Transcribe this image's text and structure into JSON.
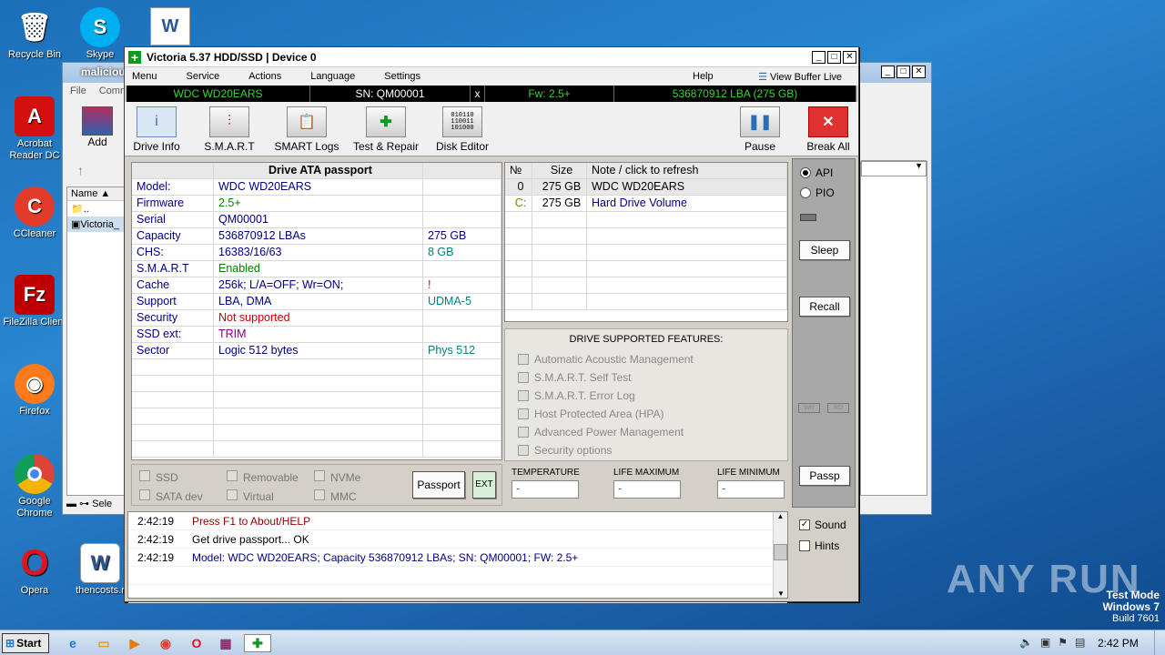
{
  "desktop": {
    "icons": [
      {
        "label": "Recycle Bin"
      },
      {
        "label": "Skype"
      },
      {
        "label": "Acrobat Reader DC"
      },
      {
        "label": "CCleaner"
      },
      {
        "label": "FileZilla Client"
      },
      {
        "label": "Firefox"
      },
      {
        "label": "Google Chrome"
      },
      {
        "label": "Opera"
      },
      {
        "label": "thencosts.r"
      }
    ],
    "watermark": "ANY RUN",
    "test_mode": "Test Mode",
    "os_name": "Windows 7",
    "build": "Build 7601"
  },
  "bg_window": {
    "title": "maliciou",
    "menu": [
      "File",
      "Comma"
    ],
    "add_label": "Add",
    "col_name": "Name",
    "files": [
      "..",
      "Victoria_"
    ],
    "status": "Sele"
  },
  "window": {
    "title": "Victoria 5.37 HDD/SSD | Device 0",
    "menu": [
      "Menu",
      "Service",
      "Actions",
      "Language",
      "Settings",
      "Help"
    ],
    "view_buffer": "View Buffer Live",
    "info": {
      "model": "WDC WD20EARS",
      "sn": "SN: QM00001",
      "x": "x",
      "fw": "Fw: 2.5+",
      "lba": "536870912 LBA (275 GB)"
    },
    "toolbar": {
      "drive_info": "Drive Info",
      "smart": "S.M.A.R.T",
      "smart_logs": "SMART Logs",
      "test_repair": "Test & Repair",
      "disk_editor": "Disk Editor",
      "pause": "Pause",
      "break_all": "Break All"
    },
    "passport": {
      "header": "Drive ATA passport",
      "rows": [
        {
          "k": "Model:",
          "v": "WDC WD20EARS",
          "x": ""
        },
        {
          "k": "Firmware",
          "v": "2.5+",
          "x": ""
        },
        {
          "k": "Serial",
          "v": "QM00001",
          "x": ""
        },
        {
          "k": "Capacity",
          "v": "536870912 LBAs",
          "x": "275 GB"
        },
        {
          "k": "CHS:",
          "v": "16383/16/63",
          "x": "8 GB"
        },
        {
          "k": "S.M.A.R.T",
          "v": "Enabled",
          "x": ""
        },
        {
          "k": "Cache",
          "v": "256k; L/A=OFF; Wr=ON;",
          "x": "!"
        },
        {
          "k": "Support",
          "v": "LBA, DMA",
          "x": "UDMA-5"
        },
        {
          "k": "Security",
          "v": "Not supported",
          "x": ""
        },
        {
          "k": "SSD ext:",
          "v": "TRIM",
          "x": ""
        },
        {
          "k": "Sector",
          "v": "Logic 512 bytes",
          "x": "Phys 512"
        }
      ]
    },
    "types": {
      "ssd": "SSD",
      "removable": "Removable",
      "nvme": "NVMe",
      "sata": "SATA dev",
      "virtual": "Virtual",
      "mmc": "MMC",
      "passport_btn": "Passport",
      "ext_btn": "EXT"
    },
    "drives": {
      "headers": [
        "№",
        "Size",
        "Note / click to refresh"
      ],
      "rows": [
        {
          "n": "0",
          "size": "275 GB",
          "note": "WDC WD20EARS"
        },
        {
          "n": "C:",
          "size": "275 GB",
          "note": "Hard Drive Volume"
        }
      ]
    },
    "features": {
      "title": "DRIVE SUPPORTED FEATURES:",
      "items": [
        "Automatic Acoustic Management",
        "S.M.A.R.T. Self Test",
        "S.M.A.R.T. Error Log",
        "Host Protected Area (HPA)",
        "Advanced Power Management",
        "Security options"
      ]
    },
    "temps": {
      "temperature": "TEMPERATURE",
      "life_max": "LIFE MAXIMUM",
      "life_min": "LIFE MINIMUM",
      "t_val": "-",
      "max_val": "-",
      "min_val": "-"
    },
    "right": {
      "api": "API",
      "pio": "PIO",
      "sleep": "Sleep",
      "recall": "Recall",
      "wr": "WR",
      "rd": "RD",
      "passp": "Passp",
      "sound": "Sound",
      "hints": "Hints"
    },
    "log": [
      {
        "time": "2:42:19",
        "msg": "Press F1 to About/HELP",
        "color": "#8b0000"
      },
      {
        "time": "2:42:19",
        "msg": "Get drive passport... OK",
        "color": "#000000"
      },
      {
        "time": "2:42:19",
        "msg": "Model: WDC WD20EARS; Capacity 536870912 LBAs; SN: QM00001; FW: 2.5+",
        "color": "#000080"
      }
    ]
  },
  "taskbar": {
    "start": "Start",
    "clock": "2:42 PM"
  }
}
